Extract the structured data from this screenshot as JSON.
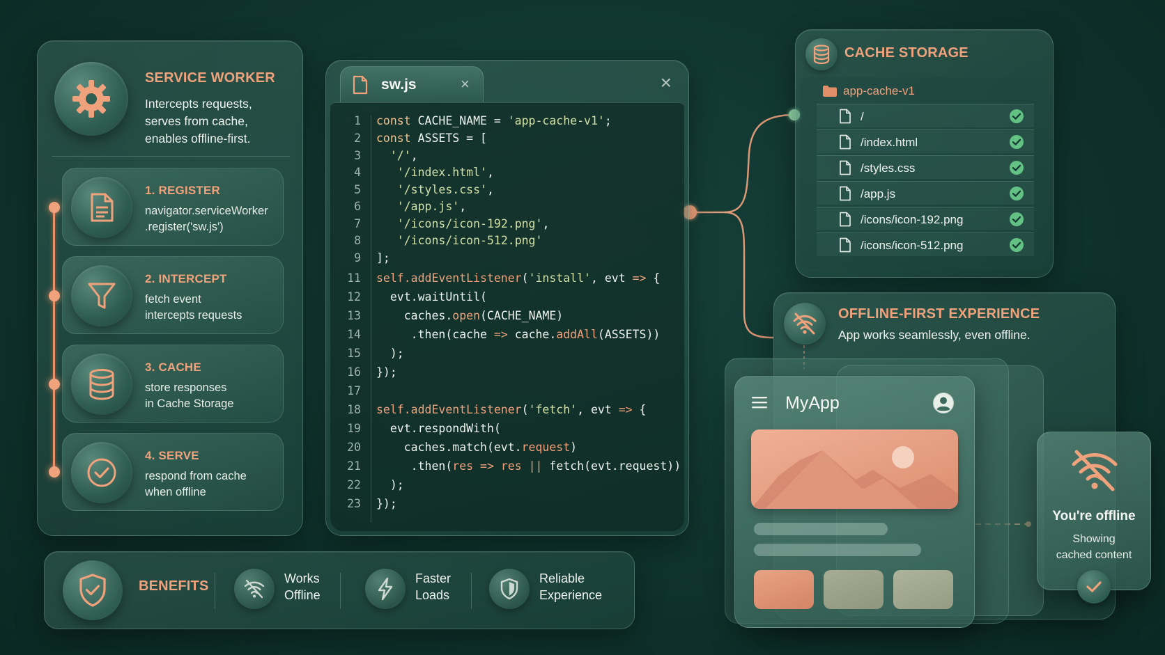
{
  "service_worker": {
    "title": "SERVICE WORKER",
    "description": "Intercepts requests, serves from cache, enables offline-first.",
    "steps": [
      {
        "title": "1. REGISTER",
        "desc": "navigator.serviceWorker\n.register('sw.js')",
        "icon": "file-icon"
      },
      {
        "title": "2. INTERCEPT",
        "desc": "fetch event\nintercepts requests",
        "icon": "filter-icon"
      },
      {
        "title": "3. CACHE",
        "desc": "store responses\nin Cache Storage",
        "icon": "database-icon"
      },
      {
        "title": "4. SERVE",
        "desc": "respond from cache\nwhen offline",
        "icon": "check-circle-icon"
      }
    ]
  },
  "editor": {
    "tab_name": "sw.js",
    "tab_close": "×",
    "window_close": "×",
    "lines": [
      {
        "n": "1",
        "t": [
          [
            "kw",
            "const "
          ],
          [
            "pl",
            "CACHE_NAME = "
          ],
          [
            "str",
            "'app-cache-v1'"
          ],
          [
            "pl",
            ";"
          ]
        ]
      },
      {
        "n": "2",
        "t": [
          [
            "kw",
            "const "
          ],
          [
            "pl",
            "ASSETS = ["
          ]
        ]
      },
      {
        "n": "3",
        "t": [
          [
            "pl",
            "  "
          ],
          [
            "str",
            "'/'"
          ],
          [
            "pl",
            ","
          ]
        ]
      },
      {
        "n": "4",
        "t": [
          [
            "pl",
            "   "
          ],
          [
            "str",
            "'/index.html'"
          ],
          [
            "pl",
            ","
          ]
        ]
      },
      {
        "n": "5",
        "t": [
          [
            "pl",
            "   "
          ],
          [
            "str",
            "'/styles.css'"
          ],
          [
            "pl",
            ","
          ]
        ]
      },
      {
        "n": "6",
        "t": [
          [
            "pl",
            "   "
          ],
          [
            "str",
            "'/app.js'"
          ],
          [
            "pl",
            ","
          ]
        ]
      },
      {
        "n": "7",
        "t": [
          [
            "pl",
            "   "
          ],
          [
            "str",
            "'/icons/icon-192.png'"
          ],
          [
            "pl",
            ","
          ]
        ]
      },
      {
        "n": "8",
        "t": [
          [
            "pl",
            "   "
          ],
          [
            "str",
            "'/icons/icon-512.png'"
          ]
        ]
      },
      {
        "n": "9",
        "t": [
          [
            "pl",
            "];"
          ]
        ]
      },
      {
        "n": "11",
        "t": [
          [
            "fn",
            "self.addEventListener"
          ],
          [
            "pl",
            "("
          ],
          [
            "str",
            "'install'"
          ],
          [
            "pl",
            ", evt "
          ],
          [
            "op",
            "=>"
          ],
          [
            "pl",
            " {"
          ]
        ]
      },
      {
        "n": "12",
        "t": [
          [
            "pl",
            "  evt.waitUntil("
          ]
        ]
      },
      {
        "n": "13",
        "t": [
          [
            "pl",
            "    caches."
          ],
          [
            "fn",
            "open"
          ],
          [
            "pl",
            "(CACHE_NAME)"
          ]
        ]
      },
      {
        "n": "14",
        "t": [
          [
            "pl",
            "     .then(cache "
          ],
          [
            "op",
            "=>"
          ],
          [
            "pl",
            " cache."
          ],
          [
            "fn",
            "addAll"
          ],
          [
            "pl",
            "(ASSETS))"
          ]
        ]
      },
      {
        "n": "15",
        "t": [
          [
            "pl",
            "  );"
          ]
        ]
      },
      {
        "n": "16",
        "t": [
          [
            "pl",
            "});"
          ]
        ]
      },
      {
        "n": "17",
        "t": [
          [
            "pl",
            ""
          ]
        ]
      },
      {
        "n": "18",
        "t": [
          [
            "fn",
            "self.addEventListener"
          ],
          [
            "pl",
            "("
          ],
          [
            "str",
            "'fetch'"
          ],
          [
            "pl",
            ", evt "
          ],
          [
            "op",
            "=>"
          ],
          [
            "pl",
            " {"
          ]
        ]
      },
      {
        "n": "19",
        "t": [
          [
            "pl",
            "  evt.respondWith("
          ]
        ]
      },
      {
        "n": "20",
        "t": [
          [
            "pl",
            "    caches.match(evt."
          ],
          [
            "fn",
            "request"
          ],
          [
            "pl",
            ")"
          ]
        ]
      },
      {
        "n": "21",
        "t": [
          [
            "pl",
            "     .then("
          ],
          [
            "fn",
            "res"
          ],
          [
            "pl",
            " "
          ],
          [
            "op",
            "=>"
          ],
          [
            "pl",
            " "
          ],
          [
            "fn",
            "res"
          ],
          [
            "pl",
            " "
          ],
          [
            "op",
            "||"
          ],
          [
            "pl",
            " fetch(evt.request))"
          ]
        ]
      },
      {
        "n": "22",
        "t": [
          [
            "pl",
            "  );"
          ]
        ]
      },
      {
        "n": "23",
        "t": [
          [
            "pl",
            "});"
          ]
        ]
      }
    ]
  },
  "cache_storage": {
    "title": "CACHE STORAGE",
    "folder": "app-cache-v1",
    "files": [
      "/",
      "/index.html",
      "/styles.css",
      "/app.js",
      "/icons/icon-192.png",
      "/icons/icon-512.png"
    ]
  },
  "offline": {
    "title": "OFFLINE-FIRST EXPERIENCE",
    "subtitle": "App works seamlessly, even offline.",
    "app_name": "MyApp",
    "toast_title": "You're offline",
    "toast_sub": "Showing\ncached content"
  },
  "benefits": {
    "title": "BENEFITS",
    "items": [
      {
        "label": "Works\nOffline",
        "icon": "wifi-off-icon"
      },
      {
        "label": "Faster\nLoads",
        "icon": "lightning-icon"
      },
      {
        "label": "Reliable\nExperience",
        "icon": "shield-check-icon"
      }
    ]
  },
  "colors": {
    "background": "#0f332d",
    "accent": "#f0a27c",
    "check_green": "#5fbf7f"
  }
}
